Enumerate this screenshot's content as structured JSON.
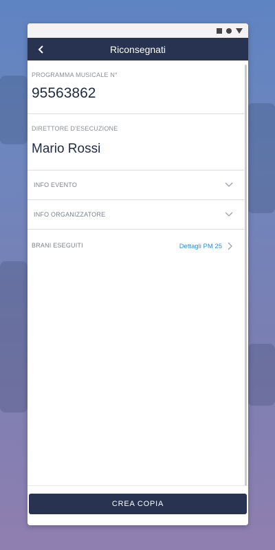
{
  "appbar": {
    "title": "Riconsegnati"
  },
  "programma": {
    "label": "PROGRAMMA MUSICALE N°",
    "value": "95563862"
  },
  "direttore": {
    "label": "DIRETTORE D'ESECUZIONE",
    "value": "Mario Rossi"
  },
  "sections": [
    {
      "label": "INFO EVENTO"
    },
    {
      "label": "INFO ORGANIZZATORE"
    }
  ],
  "brani": {
    "label": "BRANI ESEGUITI",
    "link": "Dettagli PM 25"
  },
  "footer": {
    "button_label": "CREA COPIA"
  },
  "colors": {
    "primary": "#273350",
    "link": "#2e8fd6"
  },
  "icons": {
    "back": "chevron-left-icon",
    "expand": "chevron-down-icon",
    "next": "chevron-right-icon"
  }
}
